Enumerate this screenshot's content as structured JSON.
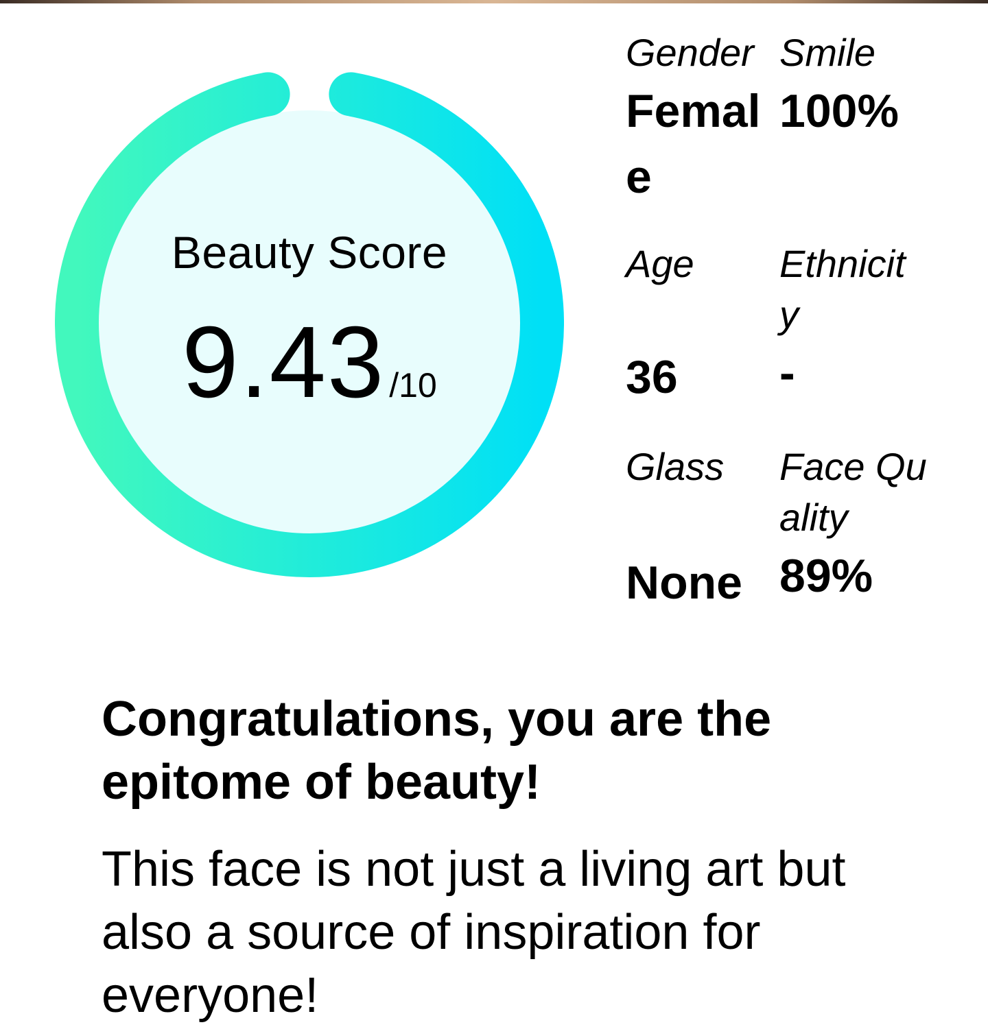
{
  "score": {
    "label": "Beauty Score",
    "value": "9.43",
    "max": "/10",
    "fraction": 0.943,
    "colors": {
      "ring_start": "#42f8bd",
      "ring_end": "#00e0f6",
      "inner_fill": "#e8fdfd"
    }
  },
  "attributes": [
    {
      "label": "Gender",
      "value": "Female"
    },
    {
      "label": "Smile",
      "value": "100%"
    },
    {
      "label": "Age",
      "value": "36"
    },
    {
      "label": "Ethnicity",
      "value": "-"
    },
    {
      "label": "Glass",
      "value": "None"
    },
    {
      "label": "Face Quality",
      "value": "89%"
    }
  ],
  "result": {
    "headline": "Congratulations, you are the epitome of beauty!",
    "description": "This face is not just a living art but also a source of inspiration for everyone!"
  }
}
